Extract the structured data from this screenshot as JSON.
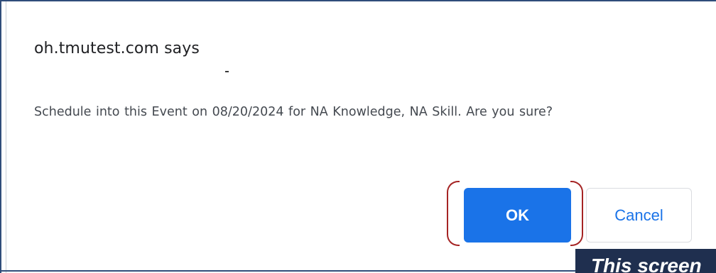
{
  "dialog": {
    "title": "oh.tmutest.com says",
    "message": "Schedule into this Event on 08/20/2024 for NA Knowledge, NA Skill.  Are you sure?",
    "ok_label": "OK",
    "cancel_label": "Cancel"
  },
  "caption": {
    "text": "This screen"
  },
  "colors": {
    "primary": "#1a73e8",
    "highlight": "#a52424",
    "caption_bg": "#1f2f4f",
    "frame": "#2f4d7a"
  }
}
